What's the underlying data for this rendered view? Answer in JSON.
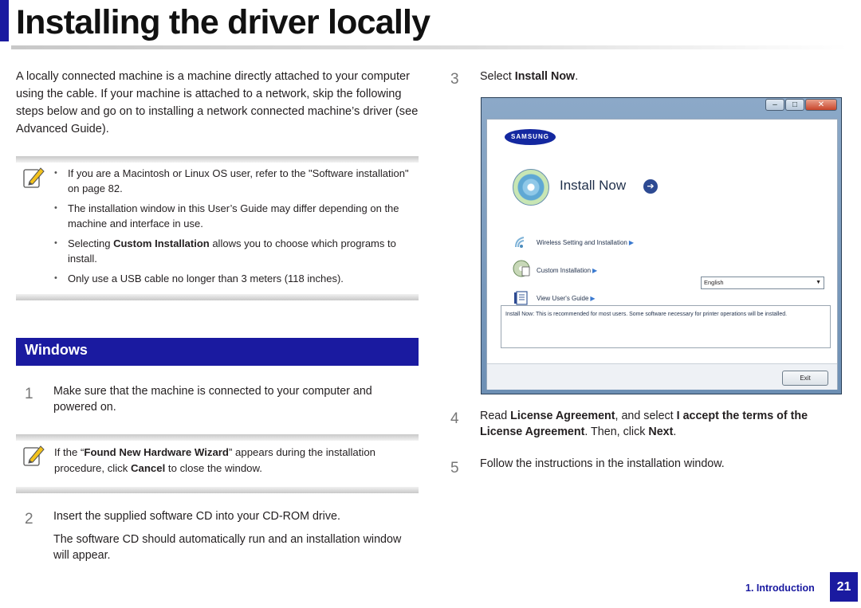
{
  "page": {
    "title": "Installing the driver locally"
  },
  "intro": "A locally connected machine is a machine directly attached to your computer using the cable. If your machine is attached to a network, skip the following steps below and go on to installing a network connected machine’s driver (see Advanced Guide).",
  "note1": {
    "items": [
      {
        "text": "If you are a Macintosh or Linux OS user, refer to the \"Software installation\" on page 82."
      },
      {
        "text": "The installation window in this User’s Guide may differ depending on the machine and interface in use."
      },
      {
        "pre": "Selecting ",
        "bold": "Custom Installation",
        "post": " allows you to choose which programs to install."
      },
      {
        "text": "Only use a USB cable no longer than 3 meters (118 inches)."
      }
    ]
  },
  "windows": {
    "heading": "Windows"
  },
  "steps": {
    "s1": {
      "num": "1",
      "text": "Make sure that the machine is connected to your computer and powered on."
    },
    "s2": {
      "num": "2",
      "text": "Insert the supplied software CD into your CD-ROM drive.",
      "text2": "The software CD should automatically run and an installation window will appear."
    },
    "s3": {
      "num": "3",
      "pre": "Select ",
      "bold": "Install Now",
      "post": "."
    },
    "s4": {
      "num": "4",
      "pre": "Read ",
      "bold1": "License Agreement",
      "mid": ", and select ",
      "bold2": "I accept the terms of the License Agreement",
      "mid2": ". Then, click ",
      "bold3": "Next",
      "post": "."
    },
    "s5": {
      "num": "5",
      "text": "Follow the instructions in the installation window."
    }
  },
  "note2": {
    "pre": "If the “",
    "bold1": "Found New Hardware Wizard",
    "mid": "” appears during the installation procedure, click ",
    "bold2": "Cancel",
    "post": " to close the window."
  },
  "installer": {
    "brand": "SAMSUNG",
    "install_now": "Install Now",
    "options": [
      {
        "label": "Wireless Setting and Installation",
        "icon": "wireless-icon"
      },
      {
        "label": "Custom Installation",
        "icon": "custom-install-icon"
      },
      {
        "label": "View User's Guide",
        "icon": "guide-icon"
      }
    ],
    "language": "English",
    "description": "Install Now: This is recommended for most users. Some software necessary for printer operations will be installed.",
    "exit": "Exit"
  },
  "footer": {
    "section": "1.  Introduction",
    "page": "21"
  },
  "colors": {
    "accent": "#1a1aa0"
  }
}
